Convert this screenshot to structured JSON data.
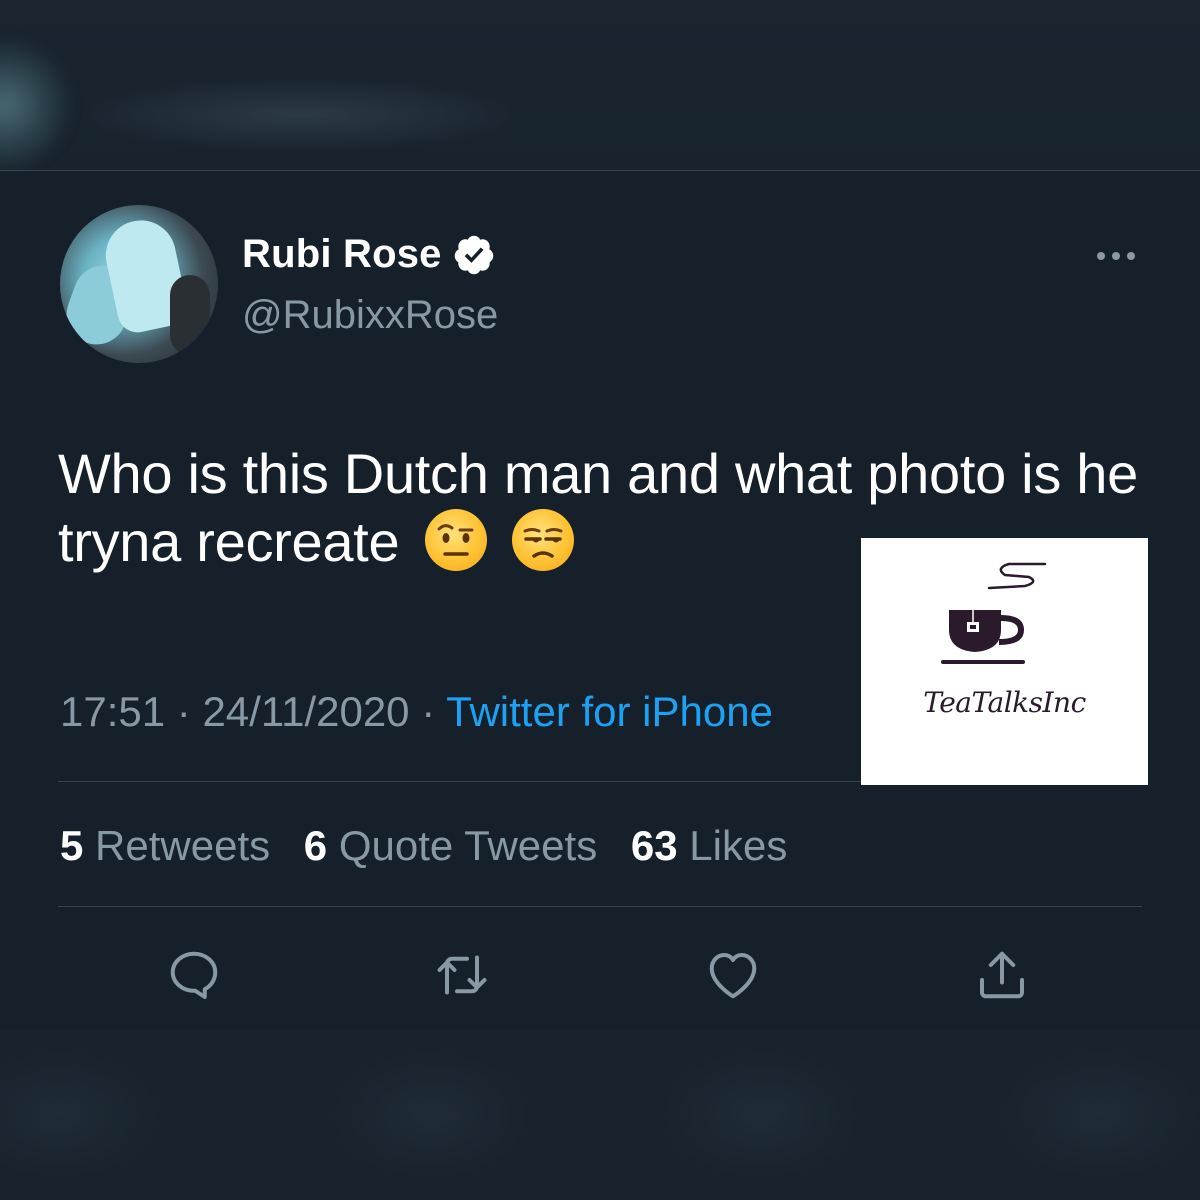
{
  "tweet": {
    "display_name": "Rubi Rose",
    "handle": "@RubixxRose",
    "text": "Who is this Dutch man and what photo is he tryna recreate",
    "emojis": [
      "face-with-raised-eyebrow",
      "unamused-face"
    ],
    "time": "17:51",
    "date": "24/11/2020",
    "source": "Twitter for iPhone",
    "separator": "·"
  },
  "stats": {
    "retweets_count": "5",
    "retweets_label": "Retweets",
    "quotes_count": "6",
    "quotes_label": "Quote Tweets",
    "likes_count": "63",
    "likes_label": "Likes"
  },
  "watermark": {
    "text": "TeaTalksInc"
  },
  "icons": [
    "verified-badge-icon",
    "more-icon",
    "reply-icon",
    "retweet-icon",
    "like-icon",
    "share-icon",
    "tea-cup-icon"
  ],
  "colors": {
    "background": "#15202b",
    "secondary_text": "#8899a6",
    "link": "#1da1f2",
    "divider": "#38444d"
  }
}
